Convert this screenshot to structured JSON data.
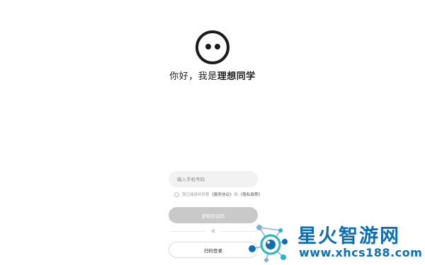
{
  "colors": {
    "logo": "#1b1b1b",
    "input_bg": "#f2f2f2",
    "button_disabled": "#c9c9c9",
    "watermark_blue": "#0e6fb3",
    "watermark_teal": "#27b6c4"
  },
  "logo": {
    "icon": "face-icon"
  },
  "greeting": {
    "prefix": "你好，我是",
    "name": "理想同学"
  },
  "login": {
    "phone_placeholder": "输入手机号码",
    "agreement_prefix": "我已阅读并同意",
    "service_link": "《服务协议》",
    "and": "和",
    "privacy_link": "《隐私政策》",
    "get_code_label": "获取验证码",
    "or_label": "或",
    "scan_label": "扫码登录"
  },
  "watermark": {
    "title": "星火智游网",
    "url": "www.xhcs188.com"
  }
}
